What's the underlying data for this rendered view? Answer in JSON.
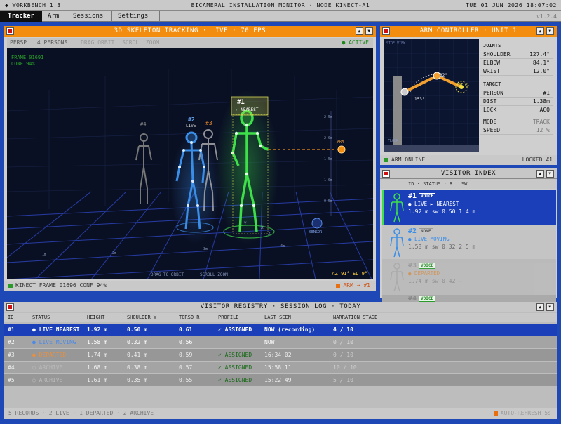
{
  "app": {
    "title": "◆ WORKBENCH 1.3",
    "center_title": "BICAMERAL INSTALLATION MONITOR · NODE KINECT-A1",
    "datetime": "TUE 01 JUN 2026 18:07:02",
    "version": "v1.2.4"
  },
  "tabs": [
    {
      "label": "Tracker",
      "active": true
    },
    {
      "label": "Arm"
    },
    {
      "label": "Sessions"
    },
    {
      "label": "Settings"
    }
  ],
  "skeleton_panel": {
    "title": "3D SKELETON TRACKING · LIVE · 70 FPS",
    "btn_up": "▲",
    "btn_down": "▼",
    "toolbar": {
      "mode": "PERSP",
      "persons": "4 PERSONS",
      "hint1": "DRAG ORBIT",
      "hint2": "SCROLL ZOOM",
      "active": "● ACTIVE"
    },
    "overlay": {
      "frame": "FRAME 01691",
      "conf": "CONF 94%",
      "drag": "DRAG TO ORBIT",
      "scroll": "SCROLL ZOOM",
      "az": "AZ 91° EL 9°",
      "sensor": "SENSOR",
      "arm": "ARM",
      "axis_x": "X",
      "axis_y": "Y",
      "axis_z": "Z",
      "heights": [
        "2.5m",
        "2.0m",
        "1.5m",
        "1.0m",
        "0.5m"
      ],
      "grid_labels": [
        "1m",
        "2m",
        "3m",
        "4m"
      ]
    },
    "persons": [
      {
        "id": "#1",
        "label": "► NEAREST",
        "color": "#3ee04a"
      },
      {
        "id": "#2",
        "label": "LIVE",
        "color": "#3a8ee8"
      },
      {
        "id": "#3",
        "label": "",
        "color": "#e88a2a"
      },
      {
        "id": "#4",
        "label": "",
        "color": "#888888"
      }
    ],
    "status": {
      "left": "KINECT FRAME 01696 CONF 94%",
      "right": "ARM → #1"
    }
  },
  "arm_panel": {
    "title": "ARM CONTROLLER · UNIT 1",
    "btn_up": "▲",
    "btn_down": "▼",
    "view_label": "SIDE VIEW",
    "floor": "FLOOR",
    "angle_a": "153°",
    "angle_b": "32°",
    "target_label": "TGT #1",
    "joints_header": "JOINTS",
    "joints": [
      {
        "name": "SHOULDER",
        "value": "127.4°"
      },
      {
        "name": "ELBOW",
        "value": "84.1°"
      },
      {
        "name": "WRIST",
        "value": "12.0°"
      }
    ],
    "target_header": "TARGET",
    "target": [
      {
        "name": "PERSON",
        "value": "#1"
      },
      {
        "name": "DIST",
        "value": "1.38m"
      },
      {
        "name": "LOCK",
        "value": "ACQ"
      }
    ],
    "mode": [
      {
        "name": "MODE",
        "value": "TRACK"
      },
      {
        "name": "SPEED",
        "value": "12 %"
      }
    ],
    "status": {
      "left": "ARM ONLINE",
      "right": "LOCKED #1"
    }
  },
  "visitor_index": {
    "title": "VISITOR INDEX",
    "btn_up": "▲",
    "btn_down": "▼",
    "columns": "ID · STATUS · R · SW",
    "cards": [
      {
        "id": "#1",
        "tag": "VOICE",
        "status": "● LIVE ► NEAREST",
        "metrics": "1.92 m  sw 0.50  1.4 m",
        "color": "#3ee04a"
      },
      {
        "id": "#2",
        "tag": "NONE",
        "status": "● LIVE MOVING",
        "metrics": "1.58 m  sw 0.32  2.5 m",
        "color": "#3a8ee8"
      },
      {
        "id": "#3",
        "tag": "VOICE",
        "status": "● DEPARTED",
        "metrics": "1.74 m  sw 0.42  –",
        "color": "#e88a2a"
      },
      {
        "id": "#4",
        "tag": "VOICE",
        "status": "",
        "metrics": "",
        "color": "#888888"
      }
    ]
  },
  "registry": {
    "title": "VISITOR REGISTRY · SESSION LOG · TODAY",
    "btn_up": "▲",
    "btn_down": "▼",
    "columns": [
      "ID",
      "STATUS",
      "HEIGHT",
      "SHOULDER W",
      "TORSO R",
      "PROFILE",
      "LAST SEEN",
      "NARRATION STAGE"
    ],
    "rows": [
      {
        "id": "#1",
        "status": "● LIVE NEAREST",
        "height": "1.92 m",
        "shoulder": "0.50 m",
        "torso": "0.61",
        "profile": "✓ ASSIGNED",
        "last": "NOW (recording)",
        "stage": "4 / 10"
      },
      {
        "id": "#2",
        "status": "● LIVE MOVING",
        "height": "1.58 m",
        "shoulder": "0.32 m",
        "torso": "0.56",
        "profile": "",
        "last": "NOW",
        "stage": "0 / 10"
      },
      {
        "id": "#3",
        "status": "● DEPARTED",
        "height": "1.74 m",
        "shoulder": "0.41 m",
        "torso": "0.59",
        "profile": "✓ ASSIGNED",
        "last": "16:34:02",
        "stage": "0 / 10"
      },
      {
        "id": "#4",
        "status": "○ ARCHIVE",
        "height": "1.68 m",
        "shoulder": "0.38 m",
        "torso": "0.57",
        "profile": "✓ ASSIGNED",
        "last": "15:58:11",
        "stage": "10 / 10"
      },
      {
        "id": "#5",
        "status": "○ ARCHIVE",
        "height": "1.61 m",
        "shoulder": "0.35 m",
        "torso": "0.55",
        "profile": "✓ ASSIGNED",
        "last": "15:22:49",
        "stage": "5 / 10"
      }
    ],
    "footer_left": "5 RECORDS · 2 LIVE · 1 DEPARTED · 2 ARCHIVE",
    "footer_right": "AUTO-REFRESH 5s"
  }
}
